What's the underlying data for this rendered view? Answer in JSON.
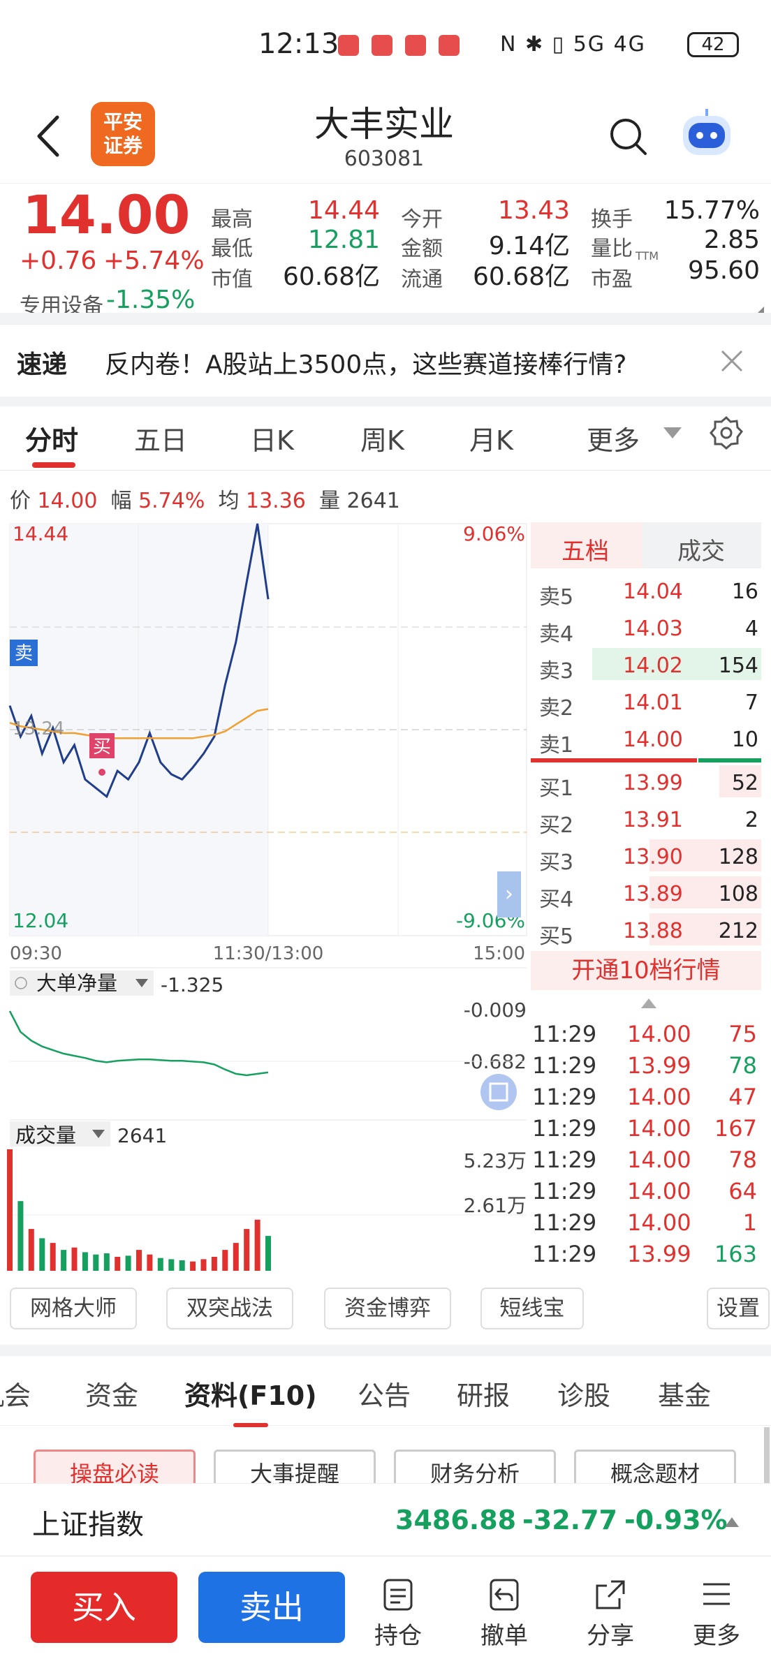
{
  "status_bar": {
    "time": "12:13",
    "system_icons": "N ✱ ▯ 5G 4G",
    "battery": "42"
  },
  "header": {
    "logo_line1": "平安",
    "logo_line2": "证券",
    "stock_name": "大丰实业",
    "stock_code": "603081"
  },
  "quote": {
    "price": "14.00",
    "change": "+0.76",
    "change_pct": "+5.74%",
    "sector_label": "专用设备",
    "sector_change": "-1.35%",
    "stats": [
      {
        "label": "最高",
        "value": "14.44",
        "color": "#e0312f"
      },
      {
        "label": "今开",
        "value": "13.43",
        "color": "#e0312f"
      },
      {
        "label": "换手",
        "value": "15.77%",
        "color": "#222222"
      },
      {
        "label": "最低",
        "value": "12.81",
        "color": "#15a060"
      },
      {
        "label": "金额",
        "value": "9.14亿",
        "color": "#222222"
      },
      {
        "label": "量比",
        "value": "2.85",
        "color": "#222222"
      },
      {
        "label": "市值",
        "value": "60.68亿",
        "color": "#222222"
      },
      {
        "label": "流通",
        "value": "60.68亿",
        "color": "#222222"
      },
      {
        "label": "市盈",
        "value": "95.60",
        "color": "#222222",
        "superscript": "TTM"
      }
    ]
  },
  "news": {
    "tag": "速递",
    "text": "反内卷！A股站上3500点，这些赛道接棒行情?"
  },
  "chart_tabs": [
    "分时",
    "五日",
    "日K",
    "周K",
    "月K",
    "更多"
  ],
  "info_line": {
    "price_label": "价",
    "price": "14.00",
    "amp_label": "幅",
    "amp": "5.74%",
    "avg_label": "均",
    "avg": "13.36",
    "vol_label": "量",
    "vol": "2641"
  },
  "chart_labels": {
    "y_top": "14.44",
    "y_bottom": "12.04",
    "pct_top": "9.06%",
    "pct_bottom": "-9.06%",
    "mid_label": "13.24",
    "sell_marker": "卖",
    "buy_marker": "买",
    "t_start": "09:30",
    "t_mid": "11:30/13:00",
    "t_end": "15:00",
    "expand_icon": "›"
  },
  "net_panel": {
    "name": "大单净量",
    "value": "-1.325",
    "level_top": "-0.009",
    "level_mid": "-0.682"
  },
  "vol_panel": {
    "name": "成交量",
    "value": "2641",
    "level_top": "5.23万",
    "level_mid": "2.61万"
  },
  "order_book": {
    "tabs": [
      "五档",
      "成交"
    ],
    "asks": [
      {
        "label": "卖5",
        "price": "14.04",
        "vol": "16"
      },
      {
        "label": "卖4",
        "price": "14.03",
        "vol": "4"
      },
      {
        "label": "卖3",
        "price": "14.02",
        "vol": "154"
      },
      {
        "label": "卖2",
        "price": "14.01",
        "vol": "7"
      },
      {
        "label": "卖1",
        "price": "14.00",
        "vol": "10"
      }
    ],
    "bids": [
      {
        "label": "买1",
        "price": "13.99",
        "vol": "52"
      },
      {
        "label": "买2",
        "price": "13.91",
        "vol": "2"
      },
      {
        "label": "买3",
        "price": "13.90",
        "vol": "128"
      },
      {
        "label": "买4",
        "price": "13.89",
        "vol": "108"
      },
      {
        "label": "买5",
        "price": "13.88",
        "vol": "212"
      }
    ],
    "open_level10": "开通10档行情"
  },
  "trades": [
    {
      "time": "11:29",
      "price": "14.00",
      "vol": "75",
      "color": "#e0312f"
    },
    {
      "time": "11:29",
      "price": "13.99",
      "vol": "78",
      "color": "#15a060"
    },
    {
      "time": "11:29",
      "price": "14.00",
      "vol": "47",
      "color": "#e0312f"
    },
    {
      "time": "11:29",
      "price": "14.00",
      "vol": "167",
      "color": "#e0312f"
    },
    {
      "time": "11:29",
      "price": "14.00",
      "vol": "78",
      "color": "#e0312f"
    },
    {
      "time": "11:29",
      "price": "14.00",
      "vol": "64",
      "color": "#e0312f"
    },
    {
      "time": "11:29",
      "price": "14.00",
      "vol": "1",
      "color": "#e0312f"
    },
    {
      "time": "11:29",
      "price": "13.99",
      "vol": "163",
      "color": "#15a060"
    }
  ],
  "tools": [
    "网格大师",
    "双突战法",
    "资金博弈",
    "短线宝",
    "设置"
  ],
  "lower_tabs": [
    "机会",
    "资金",
    "资料(F10)",
    "公告",
    "研报",
    "诊股",
    "基金"
  ],
  "chips": [
    "操盘必读",
    "大事提醒",
    "财务分析",
    "概念题材"
  ],
  "index_bar": {
    "name": "上证指数",
    "value": "3486.88",
    "change": "-32.77",
    "change_pct": "-0.93%"
  },
  "bottom_bar": {
    "buy": "买入",
    "sell": "卖出",
    "items": [
      "持仓",
      "撤单",
      "分享",
      "更多"
    ]
  },
  "colors": {
    "up": "#e0312f",
    "down": "#15a060",
    "price_line": "#1f3d8a",
    "avg_line": "#f0a030",
    "buy_button": "#e52a2a",
    "sell_button": "#1e72e3"
  },
  "chart_data": {
    "type": "line",
    "x": [
      "09:30",
      "09:35",
      "09:40",
      "09:45",
      "09:50",
      "09:55",
      "10:00",
      "10:05",
      "10:10",
      "10:15",
      "10:20",
      "10:25",
      "10:30",
      "10:35",
      "10:40",
      "10:45",
      "10:50",
      "10:55",
      "11:00",
      "11:05",
      "11:10",
      "11:15",
      "11:20",
      "11:25",
      "11:29"
    ],
    "series": [
      {
        "values": [
          13.38,
          13.2,
          13.32,
          13.1,
          13.25,
          13.05,
          13.15,
          12.95,
          12.9,
          12.85,
          13.0,
          12.95,
          13.05,
          13.22,
          13.05,
          12.98,
          12.95,
          13.02,
          13.1,
          13.2,
          13.5,
          13.75,
          14.1,
          14.44,
          14.0
        ]
      },
      {
        "values": [
          13.28,
          13.26,
          13.25,
          13.24,
          13.23,
          13.22,
          13.22,
          13.21,
          13.2,
          13.19,
          13.19,
          13.19,
          13.19,
          13.19,
          13.19,
          13.19,
          13.19,
          13.19,
          13.2,
          13.21,
          13.23,
          13.27,
          13.31,
          13.35,
          13.36
        ]
      }
    ],
    "ylim": [
      12.04,
      14.44
    ],
    "y_ref": 13.24,
    "net_values": [
      -0.009,
      -0.3,
      -0.42,
      -0.5,
      -0.55,
      -0.6,
      -0.63,
      -0.66,
      -0.7,
      -0.72,
      -0.7,
      -0.69,
      -0.68,
      -0.68,
      -0.69,
      -0.7,
      -0.7,
      -0.71,
      -0.72,
      -0.75,
      -0.82,
      -0.88,
      -0.9,
      -0.88,
      -0.86
    ],
    "volumes": [
      52300,
      30000,
      18000,
      14000,
      12000,
      9000,
      10000,
      8000,
      7000,
      7500,
      6000,
      6500,
      9000,
      7000,
      5500,
      5000,
      4500,
      4000,
      5000,
      6000,
      9000,
      12000,
      18000,
      22000,
      15000
    ]
  }
}
